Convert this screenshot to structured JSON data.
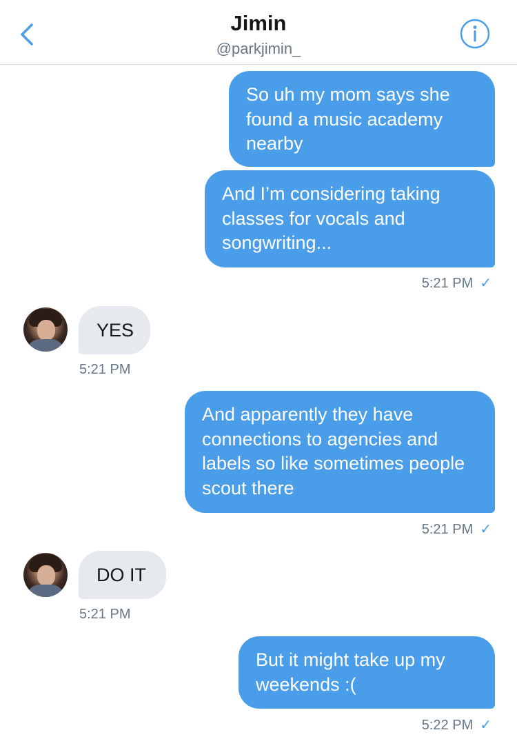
{
  "header": {
    "title": "Jimin",
    "handle": "@parkjimin_",
    "back_icon": "chevron-left-icon",
    "info_icon": "info-icon",
    "accent_color": "#4a9de8"
  },
  "messages": [
    {
      "sender": "me",
      "text": "So uh my mom says she found a music academy nearby"
    },
    {
      "sender": "me",
      "text": "And I’m considering taking classes for vocals and songwriting...",
      "time": "5:21 PM",
      "read": "✓"
    },
    {
      "sender": "them",
      "text": "YES",
      "time": "5:21 PM"
    },
    {
      "sender": "me",
      "text": "And apparently they have connections to agencies and labels so like sometimes people scout there",
      "time": "5:21 PM",
      "read": "✓"
    },
    {
      "sender": "them",
      "text": "DO IT",
      "time": "5:21 PM"
    },
    {
      "sender": "me",
      "text": "But it might take up my weekends :(",
      "time": "5:22 PM",
      "read": "✓"
    }
  ]
}
